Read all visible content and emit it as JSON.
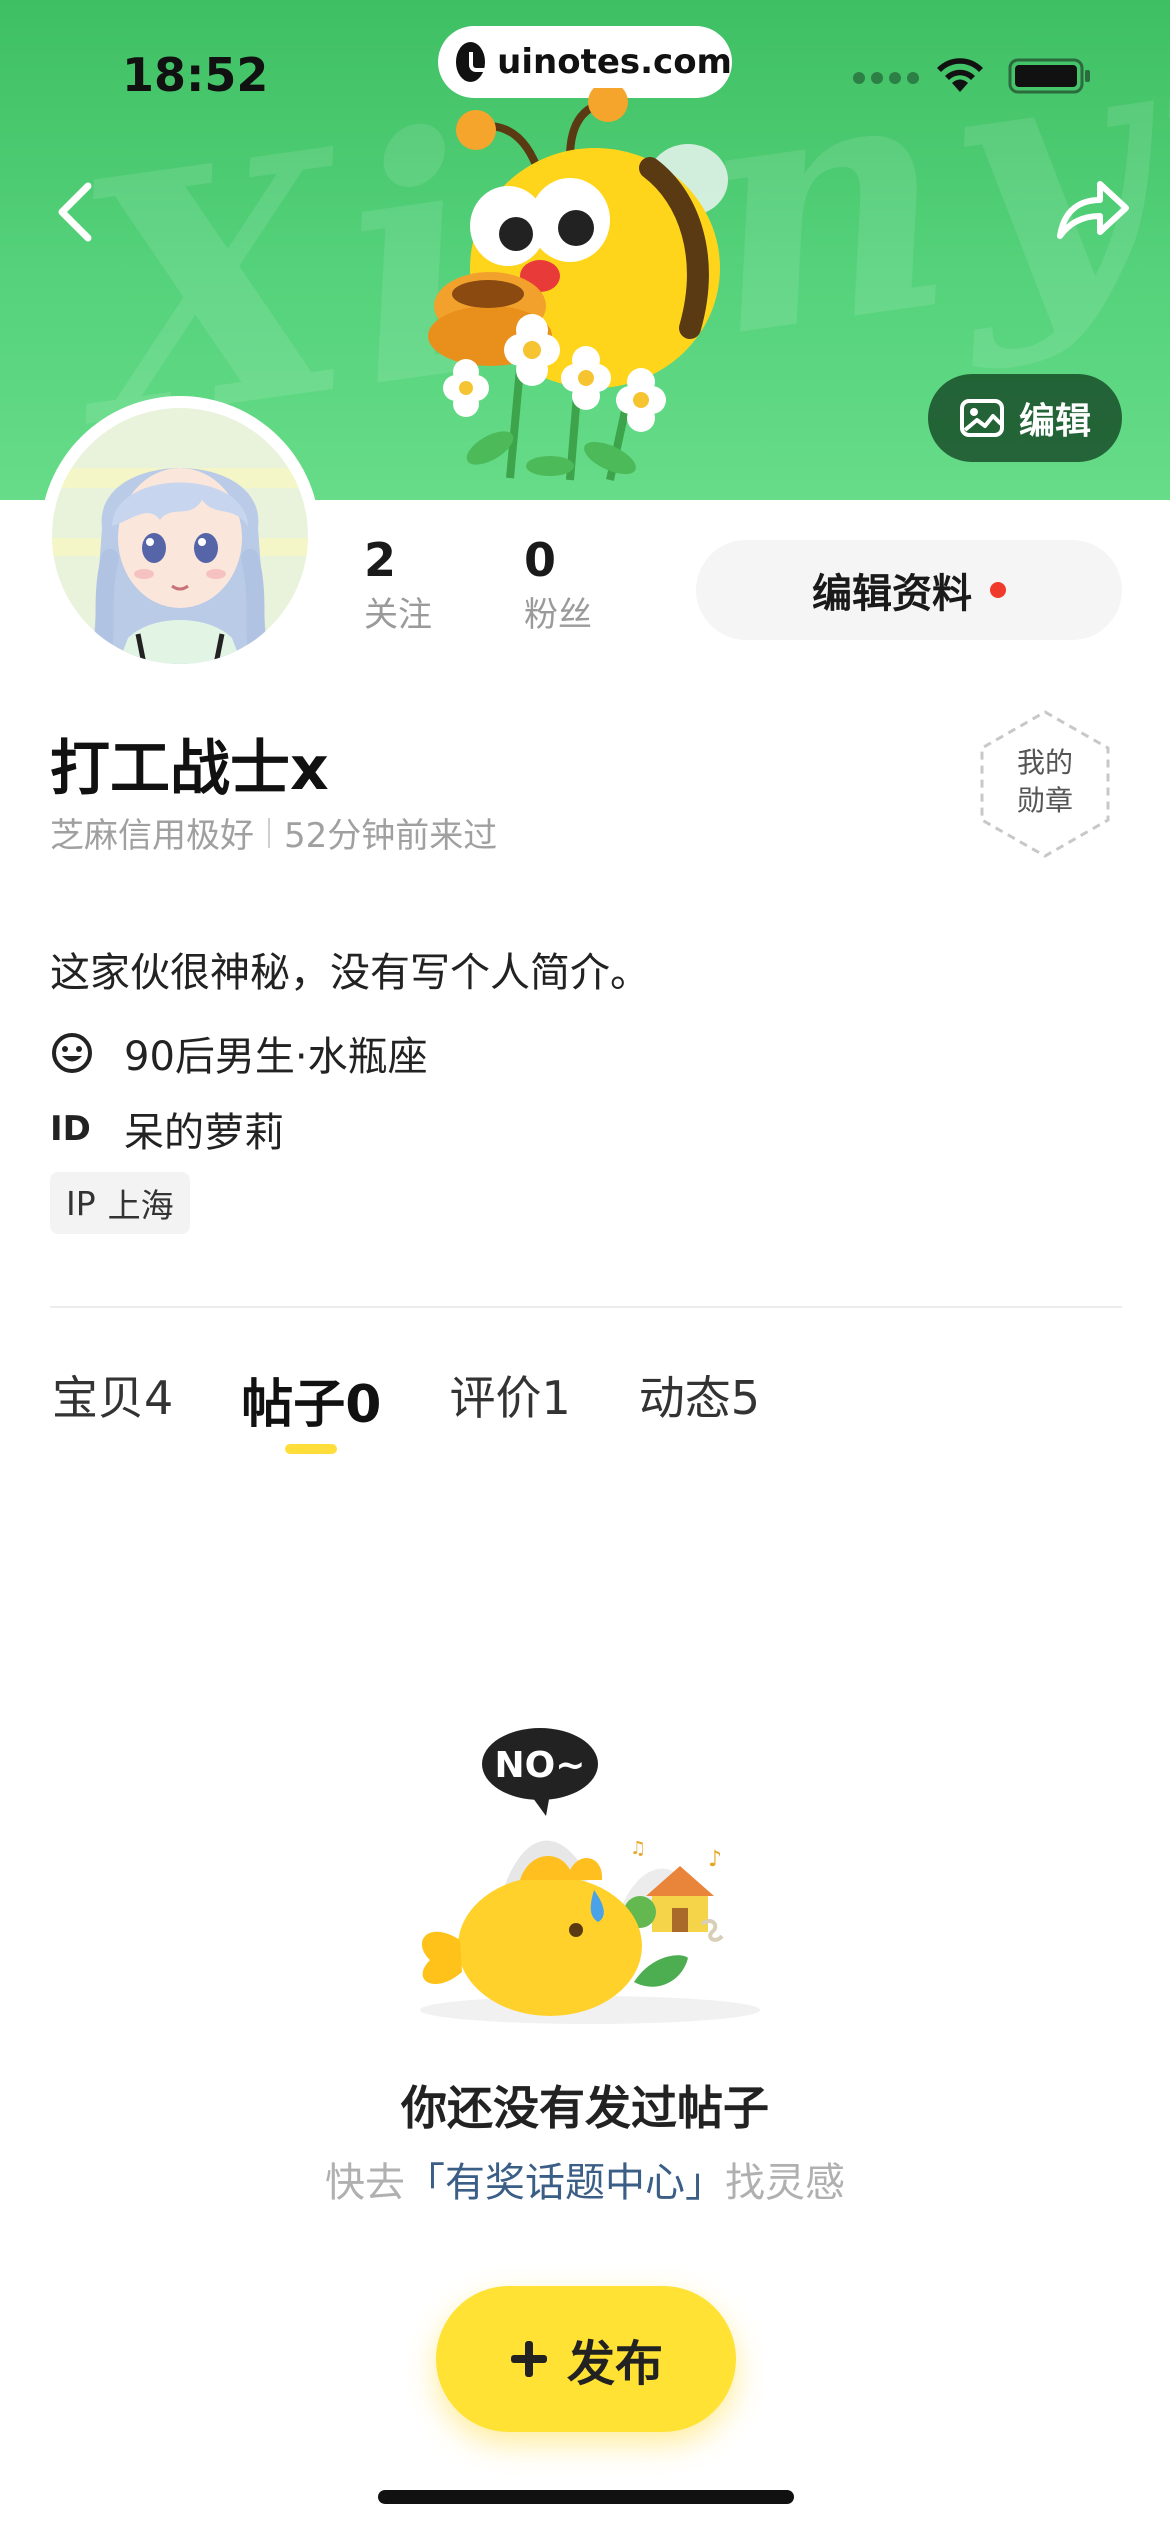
{
  "status_bar": {
    "time": "18:52",
    "url": "uinotes.com"
  },
  "header": {
    "edit_background_label": "编辑",
    "colors": {
      "banner_green": "#4fcb73",
      "accent_yellow": "#ffe234"
    }
  },
  "profile": {
    "stats": [
      {
        "value": "2",
        "label": "关注"
      },
      {
        "value": "0",
        "label": "粉丝"
      }
    ],
    "edit_profile_label": "编辑资料",
    "username": "打工战士x",
    "credit": "芝麻信用极好",
    "last_seen": "52分钟前来过",
    "badge_line1": "我的",
    "badge_line2": "勋章",
    "bio": "这家伙很神秘，没有写个人简介。",
    "demographic": "90后男生·水瓶座",
    "id_label": "ID",
    "id_value": "呆的萝莉",
    "ip_label": "IP",
    "ip_value": "上海"
  },
  "tabs": [
    {
      "label": "宝贝",
      "count": "4",
      "active": false
    },
    {
      "label": "帖子",
      "count": "0",
      "active": true
    },
    {
      "label": "评价",
      "count": "1",
      "active": false
    },
    {
      "label": "动态",
      "count": "5",
      "active": false
    }
  ],
  "empty_state": {
    "bubble_text": "NO~",
    "title": "你还没有发过帖子",
    "hint_prefix": "快去",
    "hint_link": "「有奖话题中心」",
    "hint_suffix": "找灵感"
  },
  "publish_button": {
    "label": "发布"
  }
}
